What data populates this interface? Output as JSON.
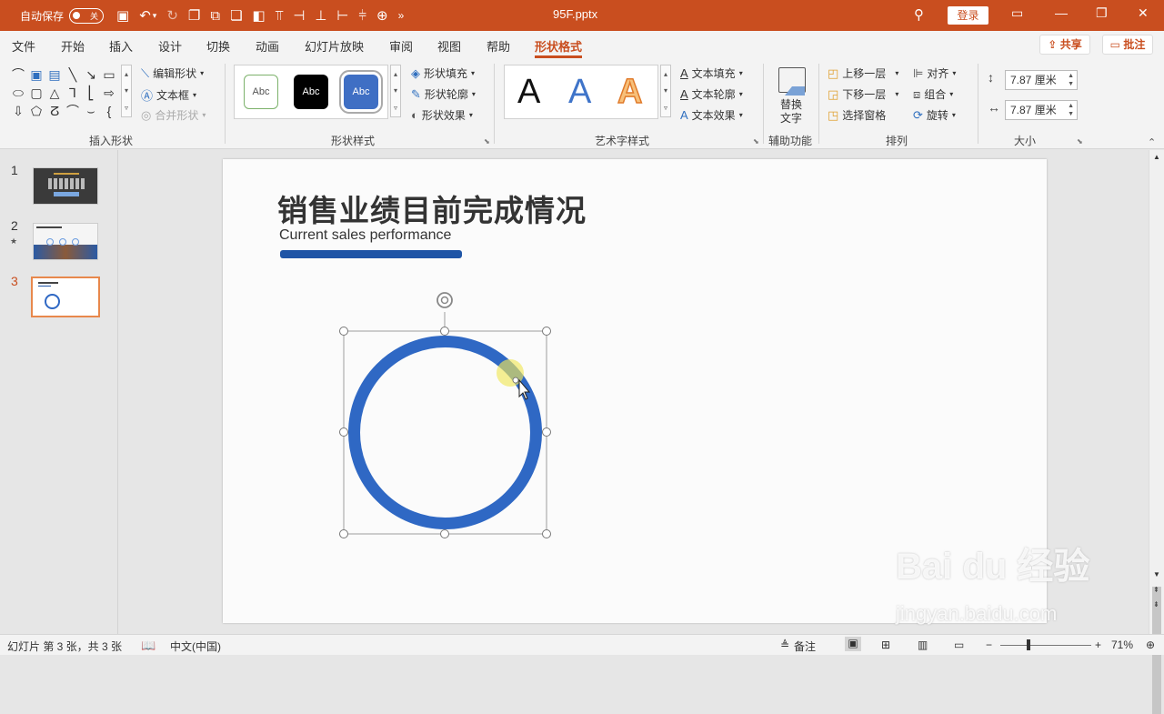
{
  "titlebar": {
    "autosave_label": "自动保存",
    "autosave_state": "关",
    "filename": "95F.pptx",
    "login_label": "登录"
  },
  "tabs": [
    "文件",
    "开始",
    "插入",
    "设计",
    "切换",
    "动画",
    "幻灯片放映",
    "审阅",
    "视图",
    "帮助",
    "形状格式"
  ],
  "active_tab": "形状格式",
  "share_label": "共享",
  "comment_label": "批注",
  "ribbon": {
    "insert_shapes": {
      "label": "插入形状",
      "edit_shape": "编辑形状",
      "text_box": "文本框",
      "merge_shapes": "合并形状"
    },
    "shape_styles": {
      "label": "形状样式",
      "swatch_text": "Abc",
      "fill": "形状填充",
      "outline": "形状轮廓",
      "effects": "形状效果"
    },
    "wordart": {
      "label": "艺术字样式",
      "letter": "A",
      "text_fill": "文本填充",
      "text_outline": "文本轮廓",
      "text_effects": "文本效果"
    },
    "accessibility": {
      "label": "辅助功能",
      "alt_text_line1": "替换",
      "alt_text_line2": "文字"
    },
    "arrange": {
      "label": "排列",
      "bring_forward": "上移一层",
      "send_backward": "下移一层",
      "selection_pane": "选择窗格",
      "align": "对齐",
      "group": "组合",
      "rotate": "旋转"
    },
    "size": {
      "label": "大小",
      "height": "7.87 厘米",
      "width": "7.87 厘米"
    }
  },
  "thumbnails": [
    {
      "number": "1"
    },
    {
      "number": "2"
    },
    {
      "number": "3"
    }
  ],
  "slide": {
    "title": "销售业绩目前完成情况",
    "subtitle": "Current sales performance",
    "accent_color": "#1f55a6",
    "ring_color": "#2f68c4"
  },
  "statusbar": {
    "slide_info": "幻灯片 第 3 张，共 3 张",
    "language": "中文(中国)",
    "notes": "备注",
    "zoom": "71%"
  },
  "watermark": {
    "brand": "Bai du 经验",
    "url": "jingyan.baidu.com"
  }
}
